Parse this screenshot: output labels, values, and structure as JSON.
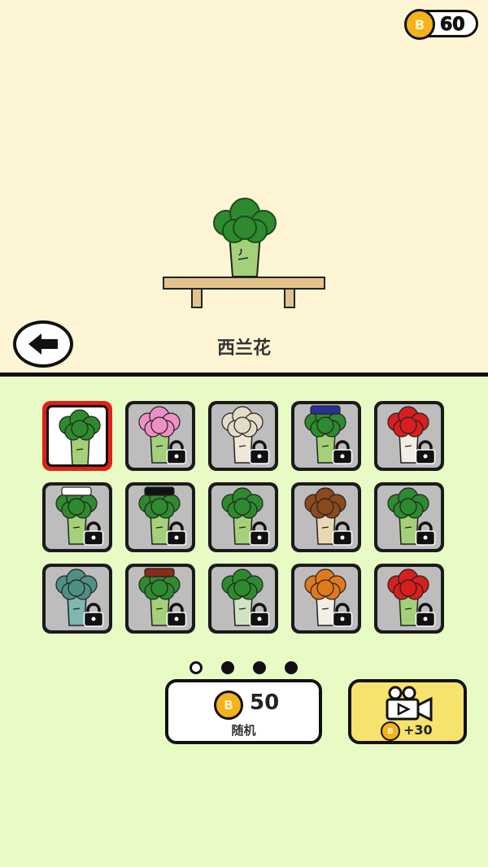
{
  "hud": {
    "coin_icon_letter": "B",
    "coins": "60"
  },
  "preview": {
    "name": "西兰花"
  },
  "grid": {
    "items": [
      {
        "id": "broccoli",
        "locked": false,
        "selected": true,
        "head": "#2e8a2e",
        "body": "#a5d07a"
      },
      {
        "id": "pink-hair",
        "locked": true,
        "head": "#f08fc6",
        "body": "#a5d07a"
      },
      {
        "id": "cauliflower",
        "locked": true,
        "head": "#e4dcc8",
        "body": "#efe8d8"
      },
      {
        "id": "police",
        "locked": true,
        "head": "#2e8a2e",
        "body": "#a5d07a",
        "hat": "#2a2f9a"
      },
      {
        "id": "clown",
        "locked": true,
        "head": "#d81e1e",
        "body": "#f3efe4"
      },
      {
        "id": "chef",
        "locked": true,
        "head": "#2e8a2e",
        "body": "#a5d07a",
        "hat": "#ffffff"
      },
      {
        "id": "magician",
        "locked": true,
        "head": "#2e8a2e",
        "body": "#a5d07a",
        "hat": "#111111"
      },
      {
        "id": "helmet",
        "locked": true,
        "head": "#2e8a2e",
        "body": "#a5d07a"
      },
      {
        "id": "brown-hair",
        "locked": true,
        "head": "#8b4a1c",
        "body": "#e8d9b4"
      },
      {
        "id": "bow",
        "locked": true,
        "head": "#2e8a2e",
        "body": "#a5d07a"
      },
      {
        "id": "zombie",
        "locked": true,
        "head": "#4f8f86",
        "body": "#7fb8b0"
      },
      {
        "id": "pirate",
        "locked": true,
        "head": "#2e8a2e",
        "body": "#a5d07a",
        "hat": "#8a2a1a"
      },
      {
        "id": "ghost",
        "locked": true,
        "head": "#2e8a2e",
        "body": "#cfe4c0"
      },
      {
        "id": "orange-hair",
        "locked": true,
        "head": "#e07a18",
        "body": "#f3efe4"
      },
      {
        "id": "red-hair",
        "locked": true,
        "head": "#d81e1e",
        "body": "#a5d07a"
      }
    ]
  },
  "pagination": {
    "pages": 4,
    "current": 1
  },
  "random": {
    "price": "50",
    "label": "随机"
  },
  "video": {
    "reward": "+30"
  },
  "colors": {
    "top_bg": "#fdf5d4",
    "bottom_bg": "#e9fbc4",
    "coin": "#f5b21e",
    "video_bg": "#f6e36e",
    "selected_border": "#e02018"
  }
}
